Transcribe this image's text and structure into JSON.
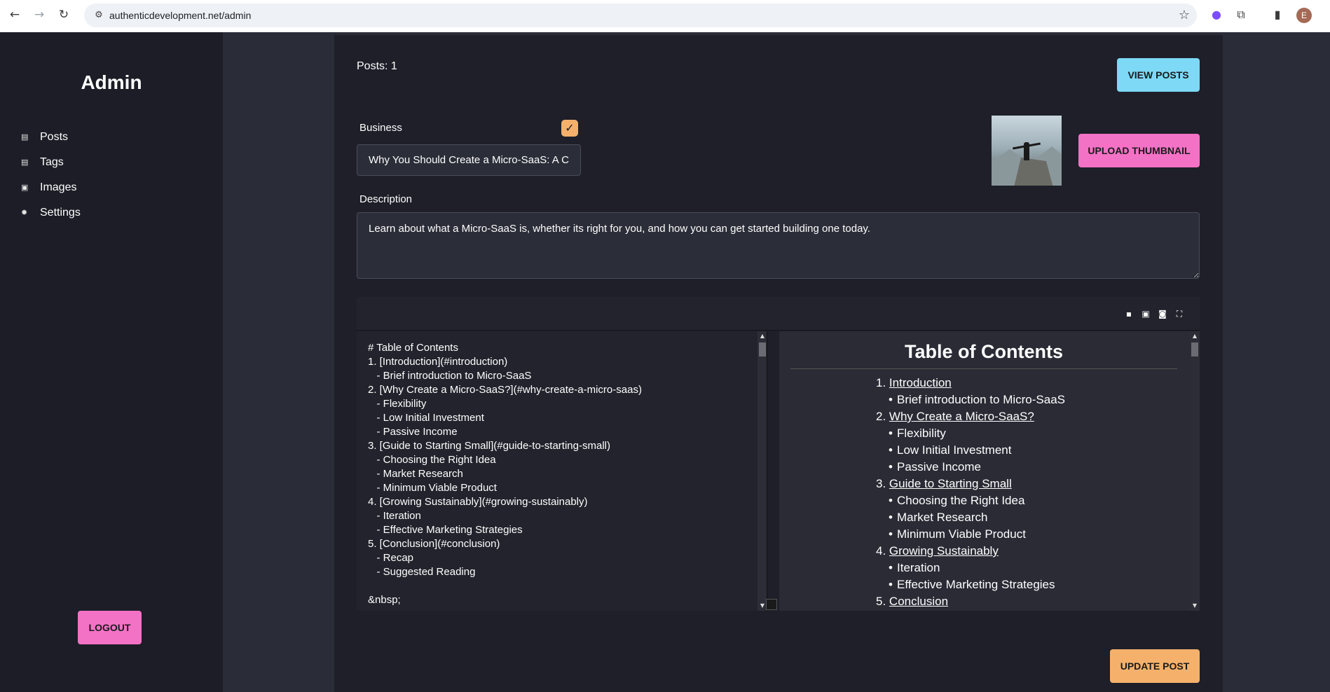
{
  "browser": {
    "url": "authenticdevelopment.net/admin",
    "profile_initial": "E"
  },
  "sidebar": {
    "brand": "Admin",
    "items": [
      {
        "label": "Posts",
        "icon": "document-icon"
      },
      {
        "label": "Tags",
        "icon": "document-icon"
      },
      {
        "label": "Images",
        "icon": "image-icon"
      },
      {
        "label": "Settings",
        "icon": "gear-icon"
      }
    ],
    "logout_label": "LOGOUT"
  },
  "main": {
    "posts_count": "Posts: 1",
    "view_posts_label": "VIEW POSTS",
    "category_label": "Business",
    "category_checked": true,
    "title_value": "Why You Should Create a Micro-SaaS: A Comprehensive Guide",
    "upload_thumbnail_label": "UPLOAD THUMBNAIL",
    "description_label": "Description",
    "description_value": "Learn about what a Micro-SaaS is, whether its right for you, and how you can get started building one today.",
    "update_post_label": "UPDATE POST"
  },
  "editor": {
    "toolbar": [
      "save-icon",
      "image-icon",
      "preview-icon",
      "fullscreen-icon"
    ],
    "source_lines": [
      "# Table of Contents",
      "1. [Introduction](#introduction)",
      "   - Brief introduction to Micro-SaaS",
      "2. [Why Create a Micro-SaaS?](#why-create-a-micro-saas)",
      "   - Flexibility",
      "   - Low Initial Investment",
      "   - Passive Income",
      "3. [Guide to Starting Small](#guide-to-starting-small)",
      "   - Choosing the Right Idea",
      "   - Market Research",
      "   - Minimum Viable Product",
      "4. [Growing Sustainably](#growing-sustainably)",
      "   - Iteration",
      "   - Effective Marketing Strategies",
      "5. [Conclusion](#conclusion)",
      "   - Recap",
      "   - Suggested Reading",
      "",
      "&nbsp;"
    ],
    "preview": {
      "title": "Table of Contents",
      "items": [
        {
          "num": "1.",
          "label": "Introduction",
          "subs": [
            "Brief introduction to Micro-SaaS"
          ]
        },
        {
          "num": "2.",
          "label": "Why Create a Micro-SaaS?",
          "subs": [
            "Flexibility",
            "Low Initial Investment",
            "Passive Income"
          ]
        },
        {
          "num": "3.",
          "label": "Guide to Starting Small",
          "subs": [
            "Choosing the Right Idea",
            "Market Research",
            "Minimum Viable Product"
          ]
        },
        {
          "num": "4.",
          "label": "Growing Sustainably",
          "subs": [
            "Iteration",
            "Effective Marketing Strategies"
          ]
        },
        {
          "num": "5.",
          "label": "Conclusion",
          "subs": []
        }
      ]
    }
  }
}
